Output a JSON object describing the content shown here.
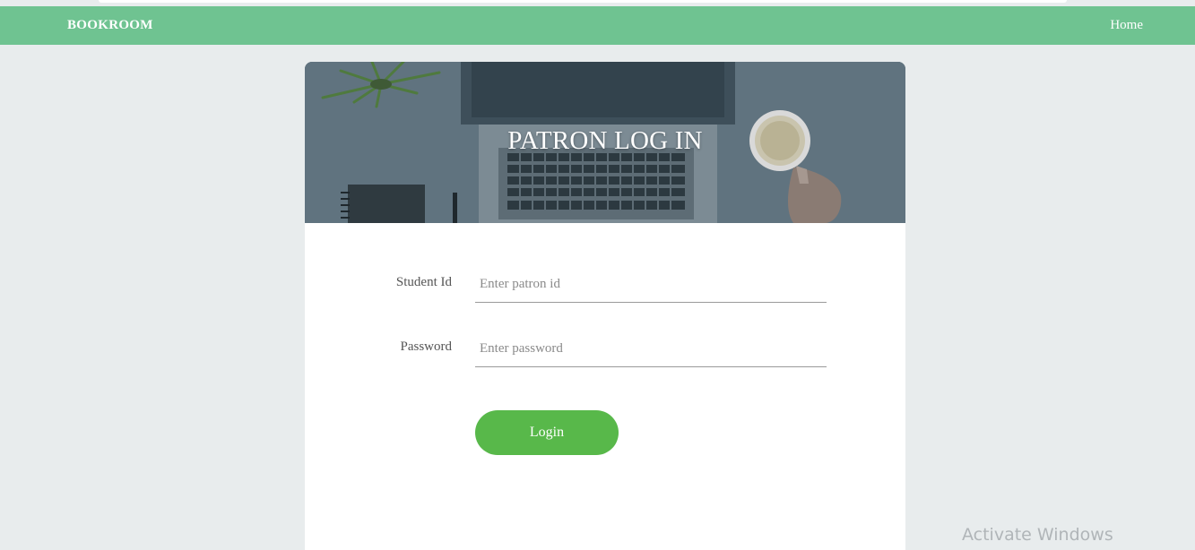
{
  "navbar": {
    "brand": "BOOKROOM",
    "home_link": "Home"
  },
  "hero": {
    "title": "PATRON LOG IN"
  },
  "form": {
    "student_id_label": "Student Id",
    "student_id_placeholder": "Enter patron id",
    "student_id_value": "",
    "password_label": "Password",
    "password_placeholder": "Enter password",
    "password_value": "",
    "login_label": "Login"
  },
  "watermark": "Activate Windows",
  "colors": {
    "navbar": "#6fc391",
    "login_button": "#58b84a",
    "page_background": "#e8eced",
    "hero_overlay": "#5d6e7a"
  }
}
